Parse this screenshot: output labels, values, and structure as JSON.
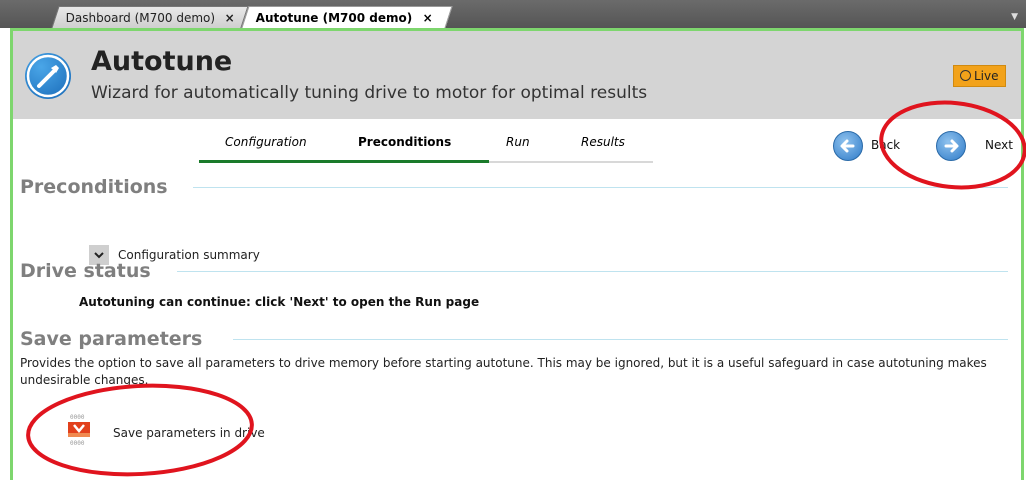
{
  "tabs": [
    {
      "label": "Dashboard (M700 demo)",
      "close": "×"
    },
    {
      "label": "Autotune (M700 demo)",
      "close": "×"
    }
  ],
  "header": {
    "title": "Autotune",
    "subtitle": "Wizard for automatically tuning drive to motor for optimal results",
    "live_label": "Live",
    "icon": "wrench-icon"
  },
  "wizard": {
    "steps": [
      "Configuration",
      "Preconditions",
      "Run",
      "Results"
    ],
    "active_step": "Preconditions",
    "back_label": "Back",
    "next_label": "Next"
  },
  "sections": {
    "preconditions": {
      "title": "Preconditions",
      "summary_label": "Configuration summary"
    },
    "drive_status": {
      "title": "Drive status",
      "message": "Autotuning can continue: click 'Next' to open the Run page"
    },
    "save_parameters": {
      "title": "Save parameters",
      "description": "Provides the option to save all parameters to drive memory before starting autotune. This may be ignored, but it is a useful safeguard in case autotuning makes undesirable changes.",
      "button_label": "Save parameters in drive"
    }
  },
  "colors": {
    "frame_border": "#7ed66e",
    "live_badge": "#f2a21a",
    "active_step_underline": "#1a7a2a",
    "annotation": "#e0141e"
  }
}
